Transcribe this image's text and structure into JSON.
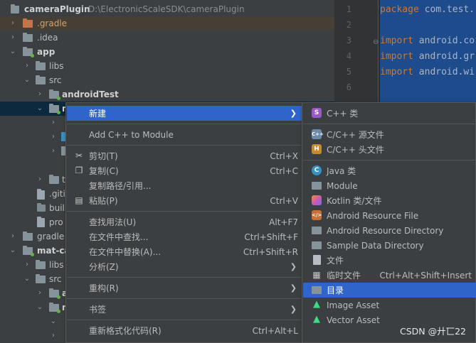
{
  "project_tree": {
    "root_name": "cameraPlugin",
    "root_path": "D:\\ElectronicScaleSDK\\cameraPlugin",
    "items": [
      {
        "label": "cameraPlugin"
      },
      {
        "label": ".gradle"
      },
      {
        "label": ".idea"
      },
      {
        "label": "app"
      },
      {
        "label": "libs"
      },
      {
        "label": "src"
      },
      {
        "label": "androidTest"
      },
      {
        "label": "m"
      },
      {
        "label": "t"
      },
      {
        "label": ".giti"
      },
      {
        "label": "buil"
      },
      {
        "label": "pro"
      },
      {
        "label": "gradle"
      },
      {
        "label": "mat-ca"
      },
      {
        "label": "libs"
      },
      {
        "label": "src"
      },
      {
        "label": "a"
      },
      {
        "label": "n"
      }
    ]
  },
  "editor": {
    "line_numbers": [
      "1",
      "2",
      "3",
      "4",
      "5",
      "6"
    ],
    "lines": [
      {
        "kw": "package",
        "rest": " com.test."
      },
      {
        "kw": "",
        "rest": ""
      },
      {
        "kw": "import",
        "rest": " android.co"
      },
      {
        "kw": "import",
        "rest": " android.gr"
      },
      {
        "kw": "import",
        "rest": " android.wi"
      },
      {
        "kw": "",
        "rest": ""
      }
    ]
  },
  "context_menu": {
    "items": [
      {
        "label": "新建",
        "shortcut": "",
        "has_submenu": true,
        "highlighted": true
      },
      {
        "label": "Add C++ to Module",
        "shortcut": ""
      },
      {
        "label": "剪切(T)",
        "shortcut": "Ctrl+X",
        "icon": "scissors-icon"
      },
      {
        "label": "复制(C)",
        "shortcut": "Ctrl+C",
        "icon": "copy-icon"
      },
      {
        "label": "复制路径/引用...",
        "shortcut": ""
      },
      {
        "label": "粘贴(P)",
        "shortcut": "Ctrl+V",
        "icon": "paste-icon"
      },
      {
        "label": "查找用法(U)",
        "shortcut": "Alt+F7"
      },
      {
        "label": "在文件中查找...",
        "shortcut": "Ctrl+Shift+F"
      },
      {
        "label": "在文件中替换(A)...",
        "shortcut": "Ctrl+Shift+R"
      },
      {
        "label": "分析(Z)",
        "shortcut": "",
        "has_submenu": true
      },
      {
        "label": "重构(R)",
        "shortcut": "",
        "has_submenu": true
      },
      {
        "label": "书签",
        "shortcut": "",
        "has_submenu": true
      },
      {
        "label": "重新格式化代码(R)",
        "shortcut": "Ctrl+Alt+L"
      }
    ]
  },
  "new_submenu": {
    "items": [
      {
        "label": "C++ 类",
        "icon": "cpp-class-icon",
        "glyph": "S"
      },
      {
        "label": "C/C++ 源文件",
        "icon": "cpp-source-icon",
        "glyph": "C++"
      },
      {
        "label": "C/C++ 头文件",
        "icon": "cpp-header-icon",
        "glyph": "H"
      },
      {
        "label": "Java 类",
        "icon": "java-class-icon",
        "glyph": "C"
      },
      {
        "label": "Module",
        "icon": "module-icon"
      },
      {
        "label": "Kotlin 类/文件",
        "icon": "kotlin-icon"
      },
      {
        "label": "Android Resource File",
        "icon": "android-resource-icon",
        "glyph": "</>"
      },
      {
        "label": "Android Resource Directory",
        "icon": "folder-icon"
      },
      {
        "label": "Sample Data Directory",
        "icon": "folder-icon"
      },
      {
        "label": "文件",
        "icon": "file-icon"
      },
      {
        "label": "临时文件",
        "shortcut": "Ctrl+Alt+Shift+Insert",
        "icon": "scratch-file-icon"
      },
      {
        "label": "目录",
        "icon": "folder-icon",
        "highlighted": true
      },
      {
        "label": "Image Asset",
        "icon": "android-icon"
      },
      {
        "label": "Vector Asset",
        "icon": "android-icon"
      }
    ]
  },
  "watermark": "CSDN @廾匸22"
}
